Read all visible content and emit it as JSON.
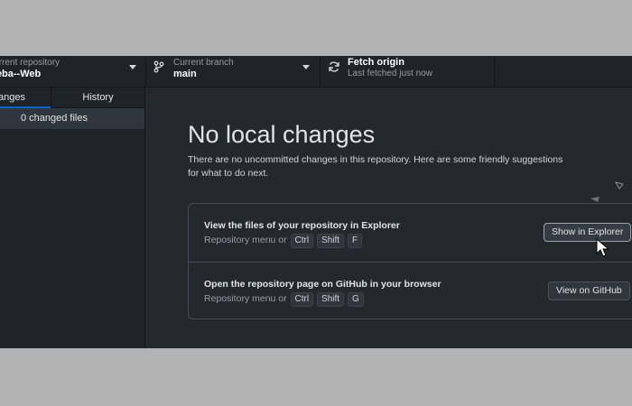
{
  "toolbar": {
    "repository": {
      "title": "Current repository",
      "value": "Heba--Web"
    },
    "branch": {
      "title": "Current branch",
      "value": "main"
    },
    "fetch": {
      "title": "Fetch origin",
      "status": "Last fetched just now"
    }
  },
  "sidebar": {
    "tabs": [
      {
        "label": "Changes",
        "active": true
      },
      {
        "label": "History",
        "active": false
      }
    ],
    "changed_files": "0 changed files"
  },
  "main": {
    "heading": "No local changes",
    "description": "There are no uncommitted changes in this repository. Here are some friendly suggestions for what to do next.",
    "suggestions": [
      {
        "title": "View the files of your repository in Explorer",
        "hint_prefix": "Repository menu or",
        "keys": [
          "Ctrl",
          "Shift",
          "F"
        ],
        "button": "Show in Explorer"
      },
      {
        "title": "Open the repository page on GitHub in your browser",
        "hint_prefix": "Repository menu or",
        "keys": [
          "Ctrl",
          "Shift",
          "G"
        ],
        "button": "View on GitHub"
      }
    ]
  },
  "colors": {
    "background": "#24292e",
    "sidebar": "#1f2428",
    "accent": "#0366d6",
    "frame": "#b3b3b3"
  }
}
